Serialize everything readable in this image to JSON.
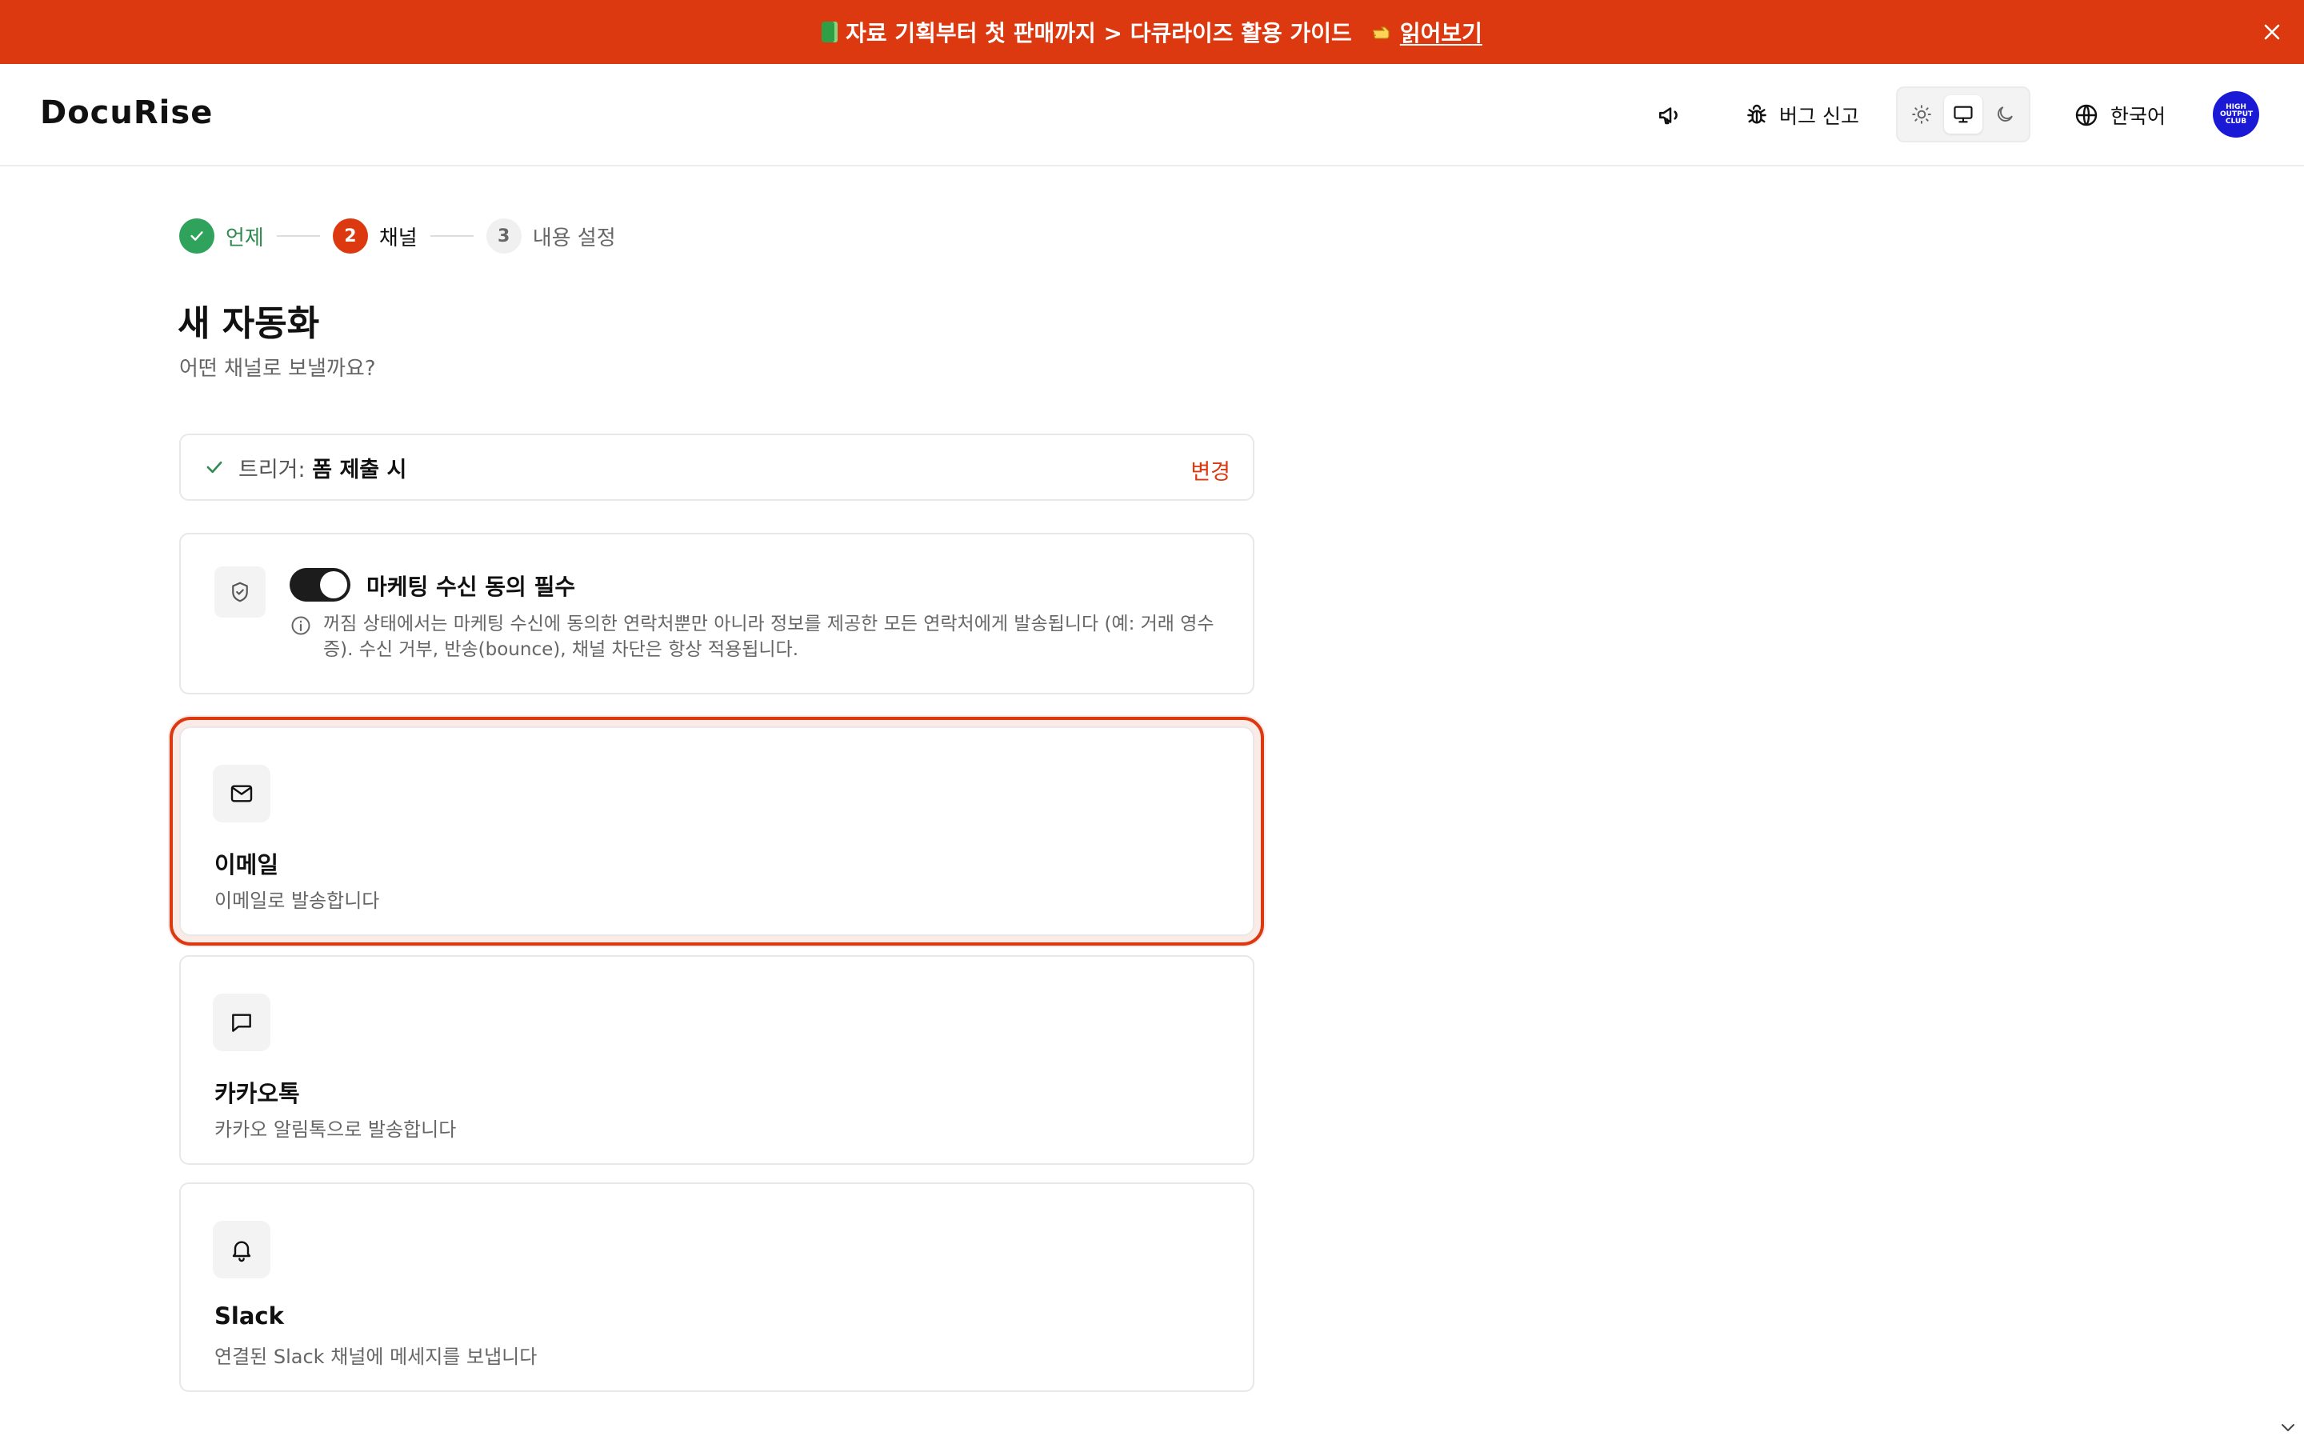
{
  "promo": {
    "message": "자료 기획부터 첫 판매까지 > 다큐라이즈 활용 가이드",
    "link_label": "읽어보기"
  },
  "header": {
    "logo": "DocuRise",
    "bug_report_label": "버그 신고",
    "language_label": "한국어",
    "avatar_text": "HIGH OUTPUT CLUB",
    "theme_options": [
      "light",
      "system",
      "dark"
    ],
    "theme_selected": "system"
  },
  "stepper": {
    "steps": [
      {
        "number": "1",
        "label": "언제",
        "state": "done"
      },
      {
        "number": "2",
        "label": "채널",
        "state": "current"
      },
      {
        "number": "3",
        "label": "내용 설정",
        "state": "todo"
      }
    ]
  },
  "page": {
    "title": "새 자동화",
    "subtitle": "어떤 채널로 보낼까요?"
  },
  "trigger": {
    "prefix": "트리거:",
    "value": "폼 제출 시",
    "change_label": "변경"
  },
  "consent": {
    "title": "마케팅 수신 동의 필수",
    "enabled": true,
    "description": "꺼짐 상태에서는 마케팅 수신에 동의한 연락처뿐만 아니라 정보를 제공한 모든 연락처에게 발송됩니다 (예: 거래 영수증). 수신 거부, 반송(bounce), 채널 차단은 항상 적용됩니다."
  },
  "channels": [
    {
      "id": "email",
      "title": "이메일",
      "description": "이메일로 발송합니다",
      "icon": "mail-icon",
      "selected": true
    },
    {
      "id": "kakao",
      "title": "카카오톡",
      "description": "카카오 알림톡으로 발송합니다",
      "icon": "message-icon",
      "selected": false
    },
    {
      "id": "slack",
      "title": "Slack",
      "description": "연결된 Slack 채널에 메세지를 보냅니다",
      "icon": "bell-icon",
      "selected": false
    }
  ],
  "colors": {
    "brand": "#dc3910",
    "success": "#2fa35b",
    "avatar": "#1a1ad6"
  }
}
